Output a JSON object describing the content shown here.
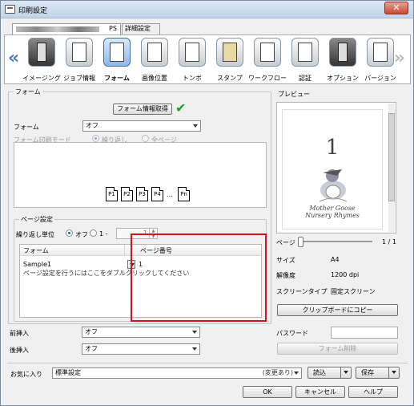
{
  "window": {
    "title": "印刷設定",
    "close_label": "✕"
  },
  "tabs": [
    {
      "label": "PS"
    },
    {
      "label": "詳細設定"
    }
  ],
  "toolbar": {
    "items": [
      {
        "label": "イメージング"
      },
      {
        "label": "ジョブ情報"
      },
      {
        "label": "フォーム"
      },
      {
        "label": "画像位置"
      },
      {
        "label": "トンボ"
      },
      {
        "label": "スタンプ"
      },
      {
        "label": "ワークフロー"
      },
      {
        "label": "認証"
      },
      {
        "label": "オプション"
      },
      {
        "label": "バージョン"
      }
    ],
    "active_index": 2
  },
  "form": {
    "group_title": "フォーム",
    "info_button": "フォーム情報取得",
    "form_label": "フォーム",
    "form_value": "オフ",
    "print_mode_label": "フォーム印刷モード",
    "mode_repeat": "繰り返し",
    "mode_all": "全ページ",
    "pages": [
      "P1",
      "P2",
      "P3",
      "P4",
      "...",
      "Pn"
    ]
  },
  "page_setting": {
    "group_title": "ページ設定",
    "repeat_unit_label": "繰り返し単位",
    "off_label": "オフ",
    "range_label": "1 -",
    "spin_value": "1",
    "table": {
      "headers": [
        "フォーム",
        "ページ番号"
      ],
      "row": {
        "form": "Sample1",
        "page": "1"
      },
      "hint": "ページ設定を行うにはここをダブルクリックしてください"
    }
  },
  "insert": {
    "before_label": "前挿入",
    "before_value": "オフ",
    "after_label": "後挿入",
    "after_value": "オフ"
  },
  "preview": {
    "title": "プレビュー",
    "page_number": "1",
    "caption": [
      "Mother Goose",
      "Nursery Rhymes"
    ],
    "page_label": "ページ",
    "page_count": "1 / 1",
    "page_fraction": 0.0,
    "size_label": "サイズ",
    "size_value": "A4",
    "resolution_label": "解像度",
    "resolution_value": "1200 dpi",
    "screen_label": "スクリーンタイプ",
    "screen_value": "固定スクリーン",
    "copy_button": "クリップボードにコピー",
    "password_label": "パスワード",
    "delete_button": "フォーム削除"
  },
  "favorites": {
    "label": "お気に入り",
    "value": "標準設定",
    "changed": "(変更あり)",
    "load_button": "読込",
    "save_button": "保存"
  },
  "footer": {
    "ok": "OK",
    "cancel": "キャンセル",
    "help": "ヘルプ"
  },
  "colors": {
    "accent": "#1a5fb4",
    "highlight_box": "#d6131b",
    "check": "#1aa31a"
  }
}
